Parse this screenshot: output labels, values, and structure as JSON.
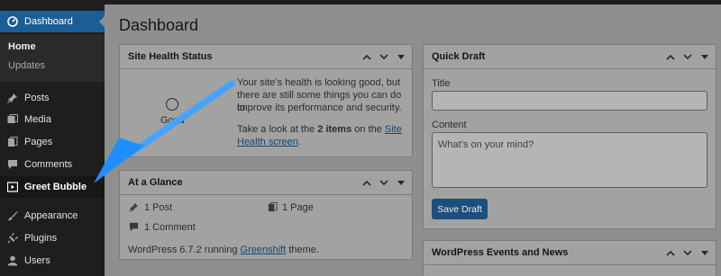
{
  "sidebar": {
    "dashboard": "Dashboard",
    "home": "Home",
    "updates": "Updates",
    "posts": "Posts",
    "media": "Media",
    "pages": "Pages",
    "comments": "Comments",
    "greet_bubble": "Greet Bubble",
    "appearance": "Appearance",
    "plugins": "Plugins",
    "users": "Users"
  },
  "page_title": "Dashboard",
  "site_health": {
    "title": "Site Health Status",
    "status": "Good",
    "line1": "Your site’s health is looking good, but",
    "line2": "there are still some things you can do to",
    "line3": "improve its performance and security.",
    "take_look_pre": "Take a look at the ",
    "items_count": "2 items",
    "on_the": " on the ",
    "link_part1": "Site",
    "link_part2": "Health screen",
    "period": "."
  },
  "at_a_glance": {
    "title": "At a Glance",
    "posts": "1 Post",
    "pages": "1 Page",
    "comments": "1 Comment",
    "footer_pre": "WordPress 6.7.2 running ",
    "theme": "Greenshift",
    "footer_post": " theme."
  },
  "quick_draft": {
    "title": "Quick Draft",
    "title_label": "Title",
    "content_label": "Content",
    "content_placeholder": "What’s on your mind?",
    "save_button": "Save Draft"
  },
  "events": {
    "title": "WordPress Events and News"
  },
  "colors": {
    "accent": "#2271b1",
    "arrow": "#1e90ff"
  }
}
